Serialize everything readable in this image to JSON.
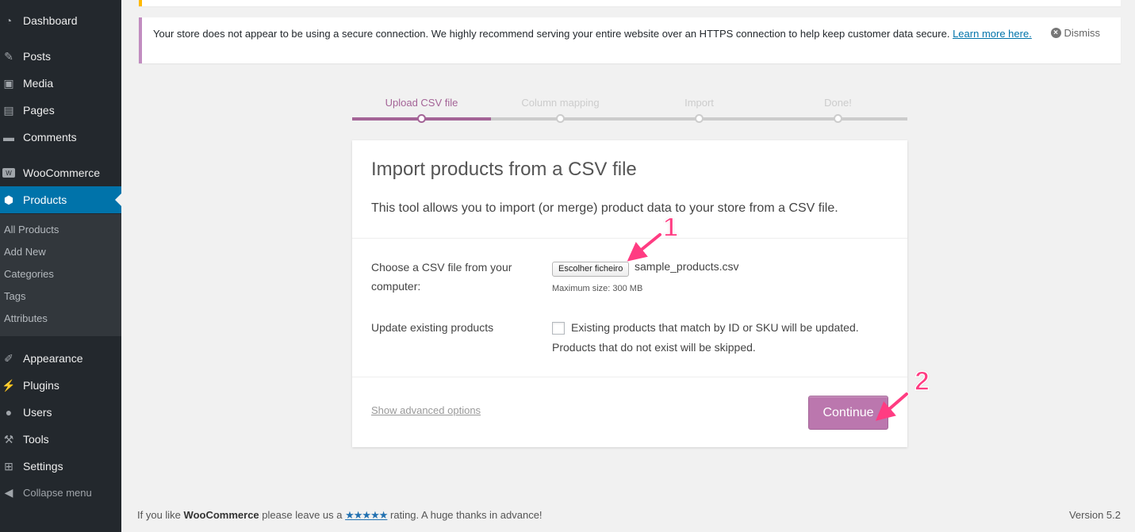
{
  "sidebar": {
    "dashboard": "Dashboard",
    "posts": "Posts",
    "media": "Media",
    "pages": "Pages",
    "comments": "Comments",
    "woocommerce": "WooCommerce",
    "products": "Products",
    "submenu": [
      "All Products",
      "Add New",
      "Categories",
      "Tags",
      "Attributes"
    ],
    "appearance": "Appearance",
    "plugins": "Plugins",
    "users": "Users",
    "tools": "Tools",
    "settings": "Settings",
    "collapse": "Collapse menu"
  },
  "notice": {
    "text": "Your store does not appear to be using a secure connection. We highly recommend serving your entire website over an HTTPS connection to help keep customer data secure.",
    "link": "Learn more here.",
    "dismiss": "Dismiss"
  },
  "steps": [
    "Upload CSV file",
    "Column mapping",
    "Import",
    "Done!"
  ],
  "card": {
    "title": "Import products from a CSV file",
    "description": "This tool allows you to import (or merge) product data to your store from a CSV file.",
    "file_label": "Choose a CSV file from your computer:",
    "file_button": "Escolher ficheiro",
    "file_name": "sample_products.csv",
    "max_size": "Maximum size: 300 MB",
    "update_label": "Update existing products",
    "update_desc": "Existing products that match by ID or SKU will be updated. Products that do not exist will be skipped.",
    "update_checked": false,
    "advanced_link": "Show advanced options",
    "continue": "Continue"
  },
  "annotations": [
    "1",
    "2"
  ],
  "footer": {
    "left_prefix": "If you like",
    "left_brand": "WooCommerce",
    "left_mid": "please leave us a",
    "left_stars": "★★★★★",
    "left_suffix": "rating. A huge thanks in advance!",
    "version": "Version 5.2"
  },
  "colors": {
    "sidebar": "#23282d",
    "active": "#0073aa",
    "woo_purple": "#a46497",
    "button": "#bb77ae",
    "annotation": "#ff3c82"
  }
}
